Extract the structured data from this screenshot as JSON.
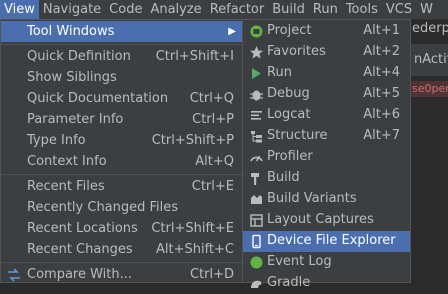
{
  "menubar": {
    "items": [
      "View",
      "Navigate",
      "Code",
      "Analyze",
      "Refactor",
      "Build",
      "Run",
      "Tools",
      "VCS",
      "W"
    ]
  },
  "background": {
    "ghost_text": "ederp",
    "tab1": "nActiv",
    "tab2": "se0per"
  },
  "view_menu": {
    "items": [
      {
        "label": "Tool Windows",
        "shortcut": ""
      },
      {
        "label": "Quick Definition",
        "shortcut": "Ctrl+Shift+I"
      },
      {
        "label": "Show Siblings",
        "shortcut": ""
      },
      {
        "label": "Quick Documentation",
        "shortcut": "Ctrl+Q"
      },
      {
        "label": "Parameter Info",
        "shortcut": "Ctrl+P"
      },
      {
        "label": "Type Info",
        "shortcut": "Ctrl+Shift+P"
      },
      {
        "label": "Context Info",
        "shortcut": "Alt+Q"
      },
      {
        "label": "Recent Files",
        "shortcut": "Ctrl+E"
      },
      {
        "label": "Recently Changed Files",
        "shortcut": ""
      },
      {
        "label": "Recent Locations",
        "shortcut": "Ctrl+Shift+E"
      },
      {
        "label": "Recent Changes",
        "shortcut": "Alt+Shift+C"
      },
      {
        "label": "Compare With...",
        "shortcut": "Ctrl+D"
      }
    ]
  },
  "tool_windows": {
    "items": [
      {
        "label": "Project",
        "shortcut": "Alt+1",
        "icon": "android-project-icon"
      },
      {
        "label": "Favorites",
        "shortcut": "Alt+2",
        "icon": "star-icon"
      },
      {
        "label": "Run",
        "shortcut": "Alt+4",
        "icon": "run-icon"
      },
      {
        "label": "Debug",
        "shortcut": "Alt+5",
        "icon": "bug-icon"
      },
      {
        "label": "Logcat",
        "shortcut": "Alt+6",
        "icon": "logcat-icon"
      },
      {
        "label": "Structure",
        "shortcut": "Alt+7",
        "icon": "structure-icon"
      },
      {
        "label": "Profiler",
        "shortcut": "",
        "icon": "profiler-icon"
      },
      {
        "label": "Build",
        "shortcut": "",
        "icon": "hammer-icon"
      },
      {
        "label": "Build Variants",
        "shortcut": "",
        "icon": "build-variants-icon"
      },
      {
        "label": "Layout Captures",
        "shortcut": "",
        "icon": "layout-captures-icon"
      },
      {
        "label": "Device File Explorer",
        "shortcut": "",
        "icon": "device-icon"
      },
      {
        "label": "Event Log",
        "shortcut": "",
        "icon": "event-log-icon"
      },
      {
        "label": "Gradle",
        "shortcut": "",
        "icon": "gradle-icon"
      }
    ]
  },
  "colors": {
    "menu_bg": "#3c3f41",
    "selection": "#4b6eaf",
    "text": "#bbbbbb"
  }
}
